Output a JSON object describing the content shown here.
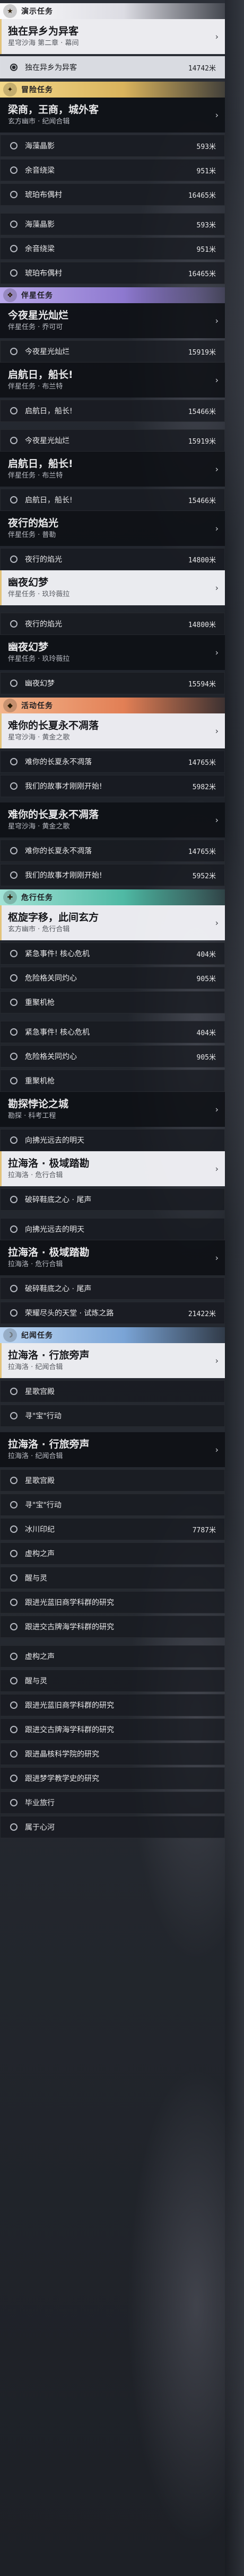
{
  "colors": {
    "gold": "#d9b35c",
    "purple": "#8d78cf",
    "orange": "#e27f55",
    "teal": "#4fb9a4",
    "blue": "#7aa4d6"
  },
  "blocks": [
    {
      "type": "section",
      "style": "s-white",
      "icon": "★",
      "label": "演示任务"
    },
    {
      "type": "mission",
      "active": true,
      "title": "独在异乡为异客",
      "subtitle": "星穹沙海 第二章 · 幕间"
    },
    {
      "type": "obj",
      "sel": true,
      "text": "独在异乡为异客",
      "dist": "14742米"
    },
    {
      "type": "section",
      "style": "s-gold",
      "icon": "✦",
      "label": "冒险任务"
    },
    {
      "type": "mission",
      "active": false,
      "title": "梁商，王商，城外客",
      "subtitle": "玄方幽市 · 纪闻合辑"
    },
    {
      "type": "obj",
      "sel": false,
      "text": "海藻晶影",
      "dist": "593米"
    },
    {
      "type": "obj",
      "sel": false,
      "text": "余音绕梁",
      "dist": "951米"
    },
    {
      "type": "obj",
      "sel": false,
      "text": "琥珀布偶村",
      "dist": "16465米"
    },
    {
      "type": "gap"
    },
    {
      "type": "obj",
      "sel": false,
      "text": "海藻晶影",
      "dist": "593米"
    },
    {
      "type": "obj",
      "sel": false,
      "text": "余音绕梁",
      "dist": "951米"
    },
    {
      "type": "obj",
      "sel": false,
      "text": "琥珀布偶村",
      "dist": "16465米"
    },
    {
      "type": "section",
      "style": "s-purple",
      "icon": "❖",
      "label": "伴星任务"
    },
    {
      "type": "mission",
      "active": false,
      "title": "今夜星光灿烂",
      "subtitle": "伴星任务 · 乔可可"
    },
    {
      "type": "obj",
      "sel": false,
      "text": "今夜星光灿烂",
      "dist": "15919米"
    },
    {
      "type": "mission",
      "active": false,
      "title": "启航日，船长!",
      "subtitle": "伴星任务 · 布兰特"
    },
    {
      "type": "obj",
      "sel": false,
      "text": "启航日，船长!",
      "dist": "15466米"
    },
    {
      "type": "gap"
    },
    {
      "type": "obj",
      "sel": false,
      "text": "今夜星光灿烂",
      "dist": "15919米"
    },
    {
      "type": "mission",
      "active": false,
      "title": "启航日，船长!",
      "subtitle": "伴星任务 · 布兰特"
    },
    {
      "type": "obj",
      "sel": false,
      "text": "启航日，船长!",
      "dist": "15466米"
    },
    {
      "type": "mission",
      "active": false,
      "title": "夜行的焰光",
      "subtitle": "伴星任务 · 普勒"
    },
    {
      "type": "obj",
      "sel": false,
      "text": "夜行的焰光",
      "dist": "14800米"
    },
    {
      "type": "mission",
      "active": true,
      "title": "幽夜幻梦",
      "subtitle": "伴星任务 · 玖玲薇拉"
    },
    {
      "type": "gap"
    },
    {
      "type": "obj",
      "sel": false,
      "text": "夜行的焰光",
      "dist": "14800米"
    },
    {
      "type": "mission",
      "active": false,
      "title": "幽夜幻梦",
      "subtitle": "伴星任务 · 玖玲薇拉"
    },
    {
      "type": "obj",
      "sel": false,
      "text": "幽夜幻梦",
      "dist": "15594米"
    },
    {
      "type": "section",
      "style": "s-orange",
      "icon": "◆",
      "label": "活动任务"
    },
    {
      "type": "mission",
      "active": true,
      "title": "难你的长夏永不凋落",
      "subtitle": "星穹沙海 · 黄金之歌"
    },
    {
      "type": "obj",
      "sel": false,
      "text": "难你的长夏永不凋落",
      "dist": "14765米"
    },
    {
      "type": "obj",
      "sel": false,
      "text": "我们的故事才刚刚开始!",
      "dist": "5982米"
    },
    {
      "type": "gap"
    },
    {
      "type": "mission",
      "active": false,
      "title": "难你的长夏永不凋落",
      "subtitle": "星穹沙海 · 黄金之歌"
    },
    {
      "type": "obj",
      "sel": false,
      "text": "难你的长夏永不凋落",
      "dist": "14765米"
    },
    {
      "type": "obj",
      "sel": false,
      "text": "我们的故事才刚刚开始!",
      "dist": "5952米"
    },
    {
      "type": "section",
      "style": "s-teal",
      "icon": "✚",
      "label": "危行任务"
    },
    {
      "type": "mission",
      "active": true,
      "title": "枢旋字移，此间玄方",
      "subtitle": "玄方幽市 · 危行合辑"
    },
    {
      "type": "obj",
      "sel": false,
      "text": "紧急事件! 核心危机",
      "dist": "404米"
    },
    {
      "type": "obj",
      "sel": false,
      "text": "危险格关同灼心",
      "dist": "905米"
    },
    {
      "type": "obj",
      "sel": false,
      "text": "重聚机枪",
      "dist": ""
    },
    {
      "type": "gap"
    },
    {
      "type": "obj",
      "sel": false,
      "text": "紧急事件! 核心危机",
      "dist": "404米"
    },
    {
      "type": "obj",
      "sel": false,
      "text": "危险格关同灼心",
      "dist": "905米"
    },
    {
      "type": "obj",
      "sel": false,
      "text": "重聚机枪",
      "dist": ""
    },
    {
      "type": "mission",
      "active": false,
      "title": "勘探悖论之城",
      "subtitle": "勘探 · 科考工程"
    },
    {
      "type": "obj",
      "sel": false,
      "text": "向拂光远去的明天",
      "dist": ""
    },
    {
      "type": "mission",
      "active": true,
      "title": "拉海洛 · 极域踏勘",
      "subtitle": "拉海洛 · 危行合辑"
    },
    {
      "type": "obj",
      "sel": false,
      "text": "破碎鞋底之心 · 尾声",
      "dist": ""
    },
    {
      "type": "gap"
    },
    {
      "type": "obj",
      "sel": false,
      "text": "向拂光远去的明天",
      "dist": ""
    },
    {
      "type": "mission",
      "active": false,
      "title": "拉海洛 · 极域踏勘",
      "subtitle": "拉海洛 · 危行合辑"
    },
    {
      "type": "obj",
      "sel": false,
      "text": "破碎鞋底之心 · 尾声",
      "dist": ""
    },
    {
      "type": "obj",
      "sel": false,
      "text": "荣耀尽头的天堂 · 试炼之路",
      "dist": "21422米"
    },
    {
      "type": "section",
      "style": "s-blue",
      "icon": "☽",
      "label": "纪闻任务"
    },
    {
      "type": "mission",
      "active": true,
      "title": "拉海洛 · 行旅旁声",
      "subtitle": "拉海洛 · 纪闻合辑"
    },
    {
      "type": "obj",
      "sel": false,
      "text": "星歌宫殿",
      "dist": ""
    },
    {
      "type": "obj",
      "sel": false,
      "text": "寻\"宝\"行动",
      "dist": ""
    },
    {
      "type": "gap"
    },
    {
      "type": "mission",
      "active": false,
      "title": "拉海洛 · 行旅旁声",
      "subtitle": "拉海洛 · 纪闻合辑"
    },
    {
      "type": "obj",
      "sel": false,
      "text": "星歌宫殿",
      "dist": ""
    },
    {
      "type": "obj",
      "sel": false,
      "text": "寻\"宝\"行动",
      "dist": ""
    },
    {
      "type": "obj",
      "sel": false,
      "text": "冰川印纪",
      "dist": "7787米"
    },
    {
      "type": "obj",
      "sel": false,
      "text": "虚构之声",
      "dist": ""
    },
    {
      "type": "obj",
      "sel": false,
      "text": "醒与灵",
      "dist": ""
    },
    {
      "type": "obj",
      "sel": false,
      "text": "跟进光蓝旧商学科群的研究",
      "dist": ""
    },
    {
      "type": "obj",
      "sel": false,
      "text": "跟进交古牌海学科群的研究",
      "dist": ""
    },
    {
      "type": "gap"
    },
    {
      "type": "obj",
      "sel": false,
      "text": "虚构之声",
      "dist": ""
    },
    {
      "type": "obj",
      "sel": false,
      "text": "醒与灵",
      "dist": ""
    },
    {
      "type": "obj",
      "sel": false,
      "text": "跟进光蓝旧商学科群的研究",
      "dist": ""
    },
    {
      "type": "obj",
      "sel": false,
      "text": "跟进交古牌海学科群的研究",
      "dist": ""
    },
    {
      "type": "obj",
      "sel": false,
      "text": "跟进晶核科学院的研究",
      "dist": ""
    },
    {
      "type": "obj",
      "sel": false,
      "text": "跟进梦学教学史的研究",
      "dist": ""
    },
    {
      "type": "obj",
      "sel": false,
      "text": "毕业旅行",
      "dist": ""
    },
    {
      "type": "obj",
      "sel": false,
      "text": "属于心河",
      "dist": ""
    }
  ]
}
